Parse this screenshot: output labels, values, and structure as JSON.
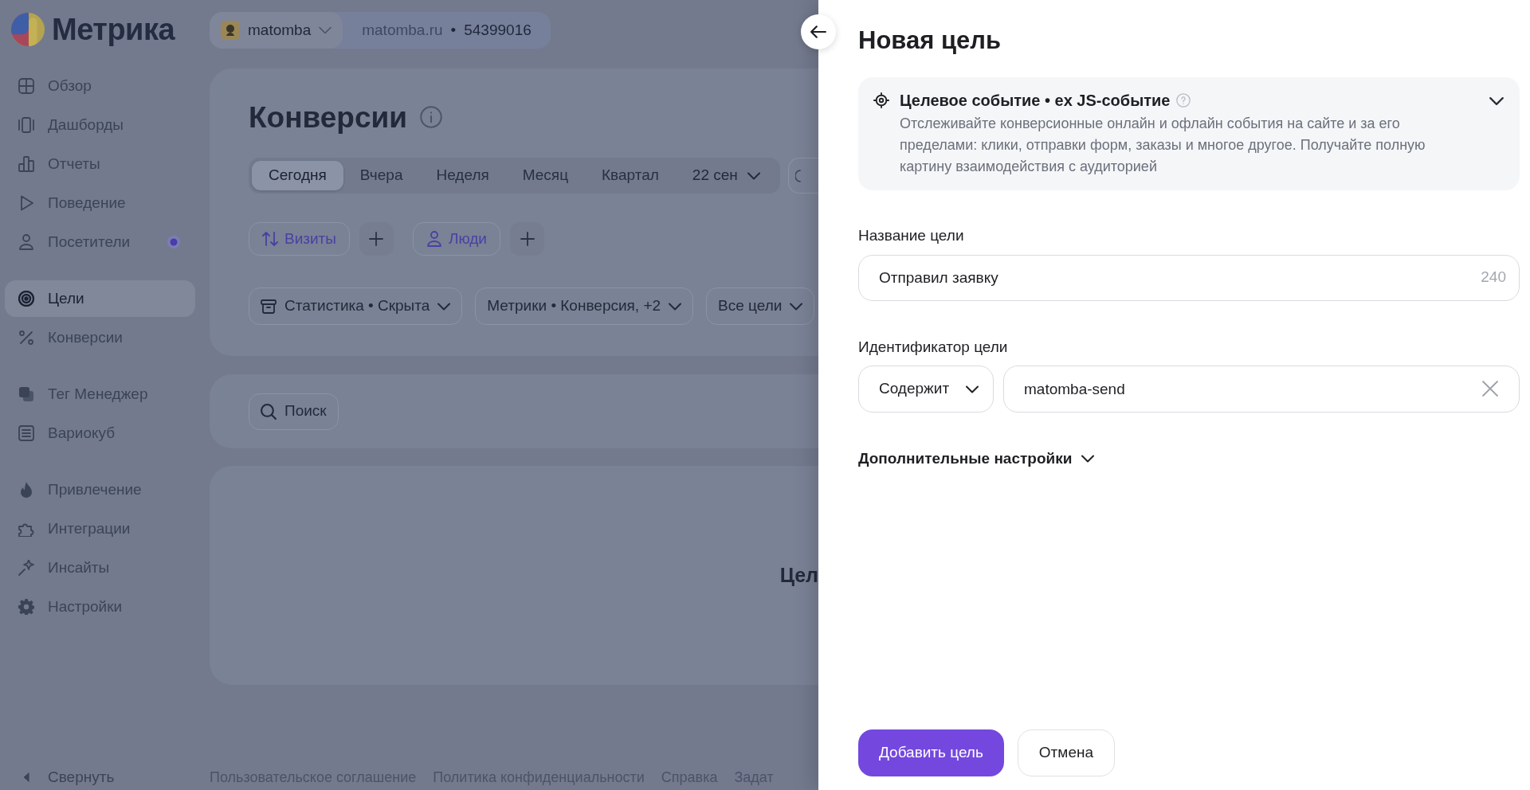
{
  "logo": {
    "text": "Метрика"
  },
  "site_selector": {
    "counter_name": "matomba",
    "domain": "matomba.ru",
    "separator": "•",
    "counter_id": "54399016"
  },
  "sidebar": {
    "groups": [
      {
        "items": [
          {
            "label": "Обзор",
            "selected": false,
            "dot": false
          },
          {
            "label": "Дашборды",
            "selected": false,
            "dot": false
          },
          {
            "label": "Отчеты",
            "selected": false,
            "dot": false
          },
          {
            "label": "Поведение",
            "selected": false,
            "dot": false
          },
          {
            "label": "Посетители",
            "selected": false,
            "dot": true
          }
        ]
      },
      {
        "items": [
          {
            "label": "Цели",
            "selected": true,
            "dot": false
          },
          {
            "label": "Конверсии",
            "selected": false,
            "dot": false
          }
        ]
      },
      {
        "items": [
          {
            "label": "Тег Менеджер",
            "selected": false,
            "dot": false
          },
          {
            "label": "Вариокуб",
            "selected": false,
            "dot": false
          }
        ]
      },
      {
        "items": [
          {
            "label": "Привлечение",
            "selected": false,
            "dot": false
          },
          {
            "label": "Интеграции",
            "selected": false,
            "dot": false
          },
          {
            "label": "Инсайты",
            "selected": false,
            "dot": false
          },
          {
            "label": "Настройки",
            "selected": false,
            "dot": false
          }
        ]
      }
    ],
    "collapse_label": "Свернуть"
  },
  "page": {
    "title": "Конверсии",
    "periods": [
      {
        "label": "Сегодня",
        "selected": true
      },
      {
        "label": "Вчера",
        "selected": false
      },
      {
        "label": "Неделя",
        "selected": false
      },
      {
        "label": "Месяц",
        "selected": false
      },
      {
        "label": "Квартал",
        "selected": false
      }
    ],
    "date_range": "22 сен",
    "segments": [
      {
        "label": "Визиты"
      },
      {
        "label": "Люди"
      }
    ],
    "filters": [
      {
        "label": "Статистика • Скрыта",
        "kind": "with_icon"
      },
      {
        "label": "Метрики • Конверсия, +2",
        "kind": "plain"
      },
      {
        "label": "Все цели",
        "kind": "plain"
      }
    ],
    "search": {
      "label": "Поиск"
    },
    "goals_card": {
      "heading": "Цел"
    }
  },
  "footer": {
    "links": [
      "Пользовательское соглашение",
      "Политика конфиденциальности",
      "Справка",
      "Задат"
    ]
  },
  "drawer": {
    "title": "Новая цель",
    "goal_type": {
      "title": "Целевое событие • ex JS-событие",
      "description": "Отслеживайте конверсионные онлайн и офлайн события на сайте и за его пределами: клики, отправки форм, заказы и многое другое. Получайте полную картину взаимодействия с аудиторией"
    },
    "name_field": {
      "label": "Название цели",
      "value": "Отправил заявку",
      "counter": "240"
    },
    "identifier_field": {
      "label": "Идентификатор цели",
      "match_type": "Содержит",
      "value": "matomba-send"
    },
    "advanced": {
      "label": "Дополнительные настройки",
      "expanded": false
    },
    "actions": [
      {
        "label": "Добавить цель",
        "kind": "primary"
      },
      {
        "label": "Отмена",
        "kind": "secondary"
      }
    ]
  }
}
